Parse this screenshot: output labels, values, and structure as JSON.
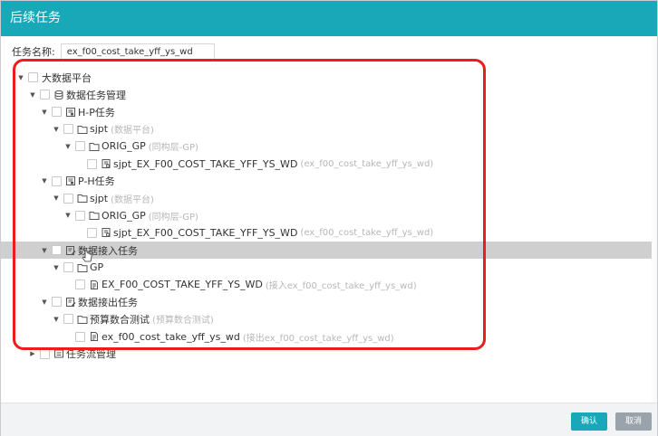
{
  "modal": {
    "title": "后续任务"
  },
  "form": {
    "label": "任务名称:",
    "value": "ex_f00_cost_take_yff_ys_wd"
  },
  "tree": [
    {
      "key": "r0",
      "indent": 0,
      "label": "大数据平台",
      "note": "",
      "icon": "none",
      "arrow": "down",
      "highlighted": false
    },
    {
      "key": "r1",
      "indent": 1,
      "label": "数据任务管理",
      "note": "",
      "icon": "database-icon",
      "arrow": "down",
      "highlighted": false
    },
    {
      "key": "r2",
      "indent": 2,
      "label": "H-P任务",
      "note": "",
      "icon": "task-group-icon",
      "arrow": "down",
      "highlighted": false
    },
    {
      "key": "r3",
      "indent": 3,
      "label": "sjpt",
      "note": "(数据平台)",
      "icon": "folder-icon",
      "arrow": "down",
      "highlighted": false
    },
    {
      "key": "r4",
      "indent": 4,
      "label": "ORIG_GP",
      "note": "(同构层-GP)",
      "icon": "folder-icon",
      "arrow": "down",
      "highlighted": false
    },
    {
      "key": "r5",
      "indent": 5,
      "label": "sjpt_EX_F00_COST_TAKE_YFF_YS_WD",
      "note": "(ex_f00_cost_take_yff_ys_wd)",
      "icon": "task-icon",
      "arrow": "none",
      "highlighted": false
    },
    {
      "key": "r6",
      "indent": 2,
      "label": "P-H任务",
      "note": "",
      "icon": "task-group-icon",
      "arrow": "down",
      "highlighted": false
    },
    {
      "key": "r7",
      "indent": 3,
      "label": "sjpt",
      "note": "(数据平台)",
      "icon": "folder-icon",
      "arrow": "down",
      "highlighted": false
    },
    {
      "key": "r8",
      "indent": 4,
      "label": "ORIG_GP",
      "note": "(同构层-GP)",
      "icon": "folder-icon",
      "arrow": "down",
      "highlighted": false
    },
    {
      "key": "r9",
      "indent": 5,
      "label": "sjpt_EX_F00_COST_TAKE_YFF_YS_WD",
      "note": "(ex_f00_cost_take_yff_ys_wd)",
      "icon": "task-icon",
      "arrow": "none",
      "highlighted": false
    },
    {
      "key": "r10",
      "indent": 2,
      "label": "数据接入任务",
      "note": "",
      "icon": "edit-doc-icon",
      "arrow": "down",
      "highlighted": true
    },
    {
      "key": "r11",
      "indent": 3,
      "label": "GP",
      "note": "",
      "icon": "folder-icon",
      "arrow": "down",
      "highlighted": false
    },
    {
      "key": "r12",
      "indent": 4,
      "label": "EX_F00_COST_TAKE_YFF_YS_WD",
      "note": "(接入ex_f00_cost_take_yff_ys_wd)",
      "icon": "doc-icon",
      "arrow": "none",
      "highlighted": false
    },
    {
      "key": "r13",
      "indent": 2,
      "label": "数据接出任务",
      "note": "",
      "icon": "edit-doc-icon",
      "arrow": "down",
      "highlighted": false
    },
    {
      "key": "r14",
      "indent": 3,
      "label": "预算数合测试",
      "note": "(预算数合测试)",
      "icon": "folder-icon",
      "arrow": "down",
      "highlighted": false
    },
    {
      "key": "r15",
      "indent": 4,
      "label": "ex_f00_cost_take_yff_ys_wd",
      "note": "(接出ex_f00_cost_take_yff_ys_wd)",
      "icon": "doc-icon",
      "arrow": "none",
      "highlighted": false
    },
    {
      "key": "r16",
      "indent": 1,
      "label": "任务流管理",
      "note": "",
      "icon": "flow-icon",
      "arrow": "right",
      "highlighted": false
    }
  ],
  "buttons": {
    "ok": "确认",
    "cancel": "取消"
  },
  "colors": {
    "header": "#19a8b8",
    "annotation": "#ee1c1c",
    "highlight": "#cfcfcf"
  }
}
